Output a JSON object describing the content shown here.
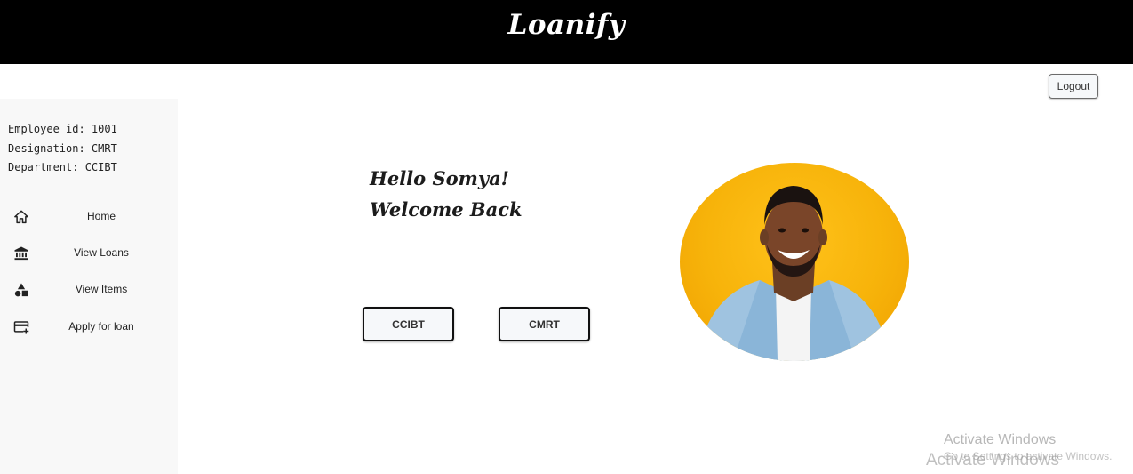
{
  "header": {
    "brand": "Loanify"
  },
  "logout": {
    "label": "Logout"
  },
  "employee": {
    "id_line": "Employee id: 1001",
    "designation_line": "Designation: CMRT",
    "department_line": "Department: CCIBT"
  },
  "sidebar": {
    "items": [
      {
        "label": "Home",
        "icon": "home-icon"
      },
      {
        "label": "View Loans",
        "icon": "bank-icon"
      },
      {
        "label": "View Items",
        "icon": "shapes-icon"
      },
      {
        "label": "Apply for loan",
        "icon": "card-add-icon"
      }
    ]
  },
  "greeting": {
    "line1": "Hello Somya!",
    "line2": "Welcome Back"
  },
  "roles": {
    "first": "CCIBT",
    "second": "CMRT"
  },
  "watermark": {
    "title": "Activate Windows",
    "subtitle": "Go to Settings to activate Windows.",
    "title_overlay": "Activate Windows"
  },
  "colors": {
    "header_bg": "#000000",
    "portrait_bg": "#f7b30a",
    "sidebar_bg": "#f8f8f8"
  }
}
